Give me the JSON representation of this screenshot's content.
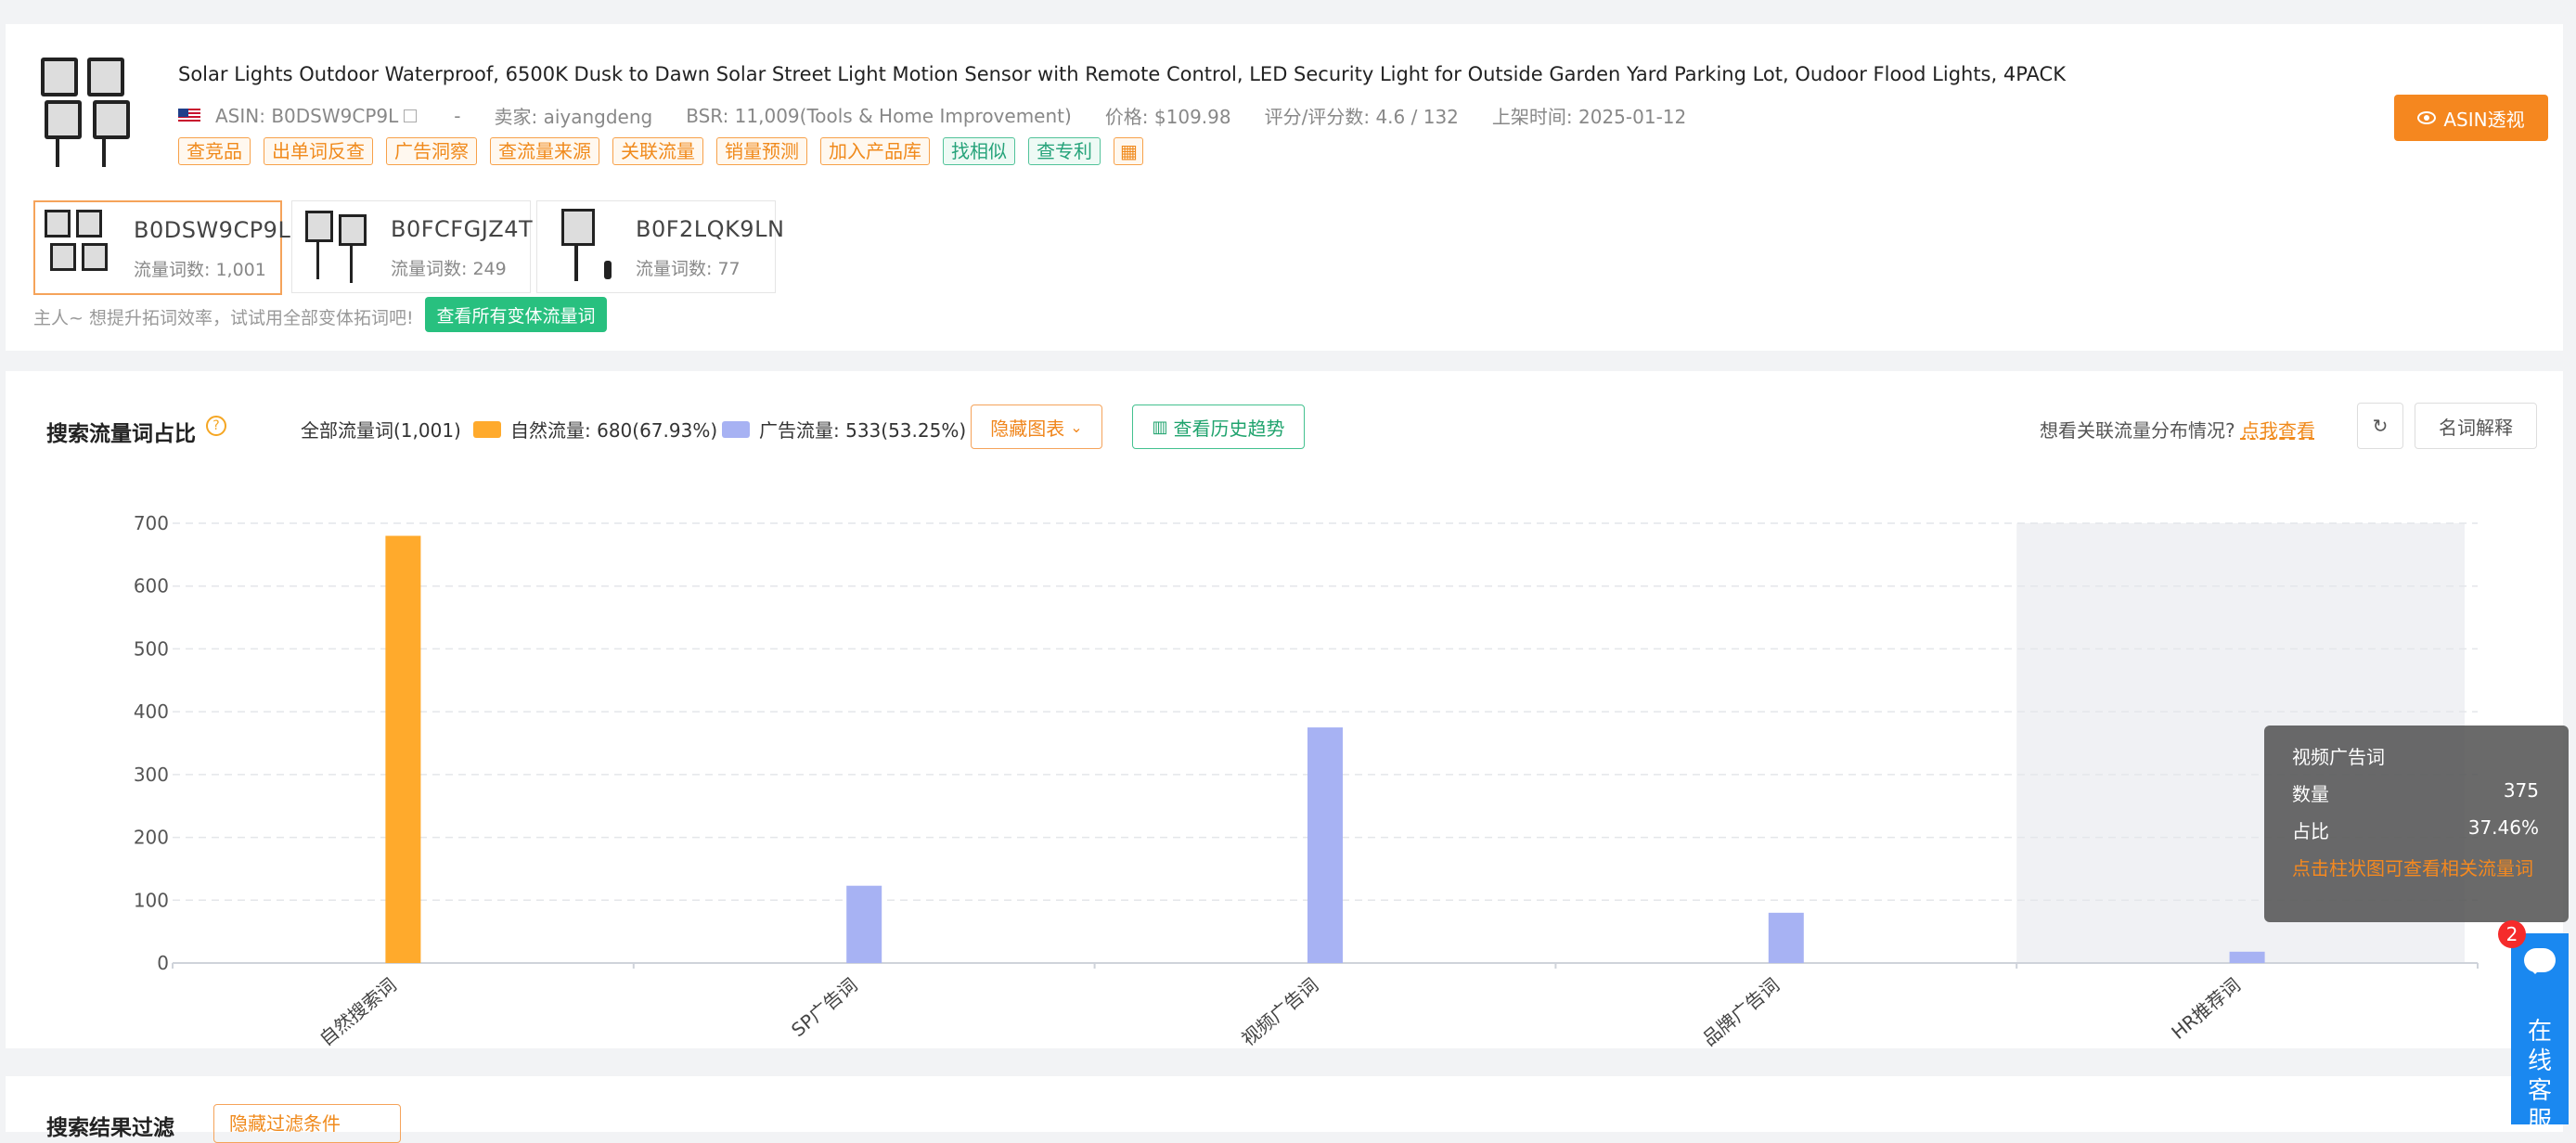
{
  "product": {
    "title": "Solar Lights Outdoor Waterproof, 6500K Dusk to Dawn Solar Street Light Motion Sensor with Remote Control, LED Security Light for Outside Garden Yard Parking Lot, Oudoor Flood Lights, 4PACK",
    "asin": "ASIN: B0DSW9CP9L",
    "dash": "-",
    "seller": "卖家: aiyangdeng",
    "bsr": "BSR: 11,009(Tools & Home Improvement)",
    "price": "价格: $109.98",
    "rating": "评分/评分数: 4.6 / 132",
    "listed": "上架时间: 2025-01-12",
    "tags": [
      "查竞品",
      "出单词反查",
      "广告洞察",
      "查流量来源",
      "关联流量",
      "销量预测",
      "加入产品库",
      "找相似",
      "查专利"
    ],
    "asin_button": "ASIN透视"
  },
  "variants": [
    {
      "asin": "B0DSW9CP9L",
      "count": "流量词数: 1,001"
    },
    {
      "asin": "B0FCFGJZ4T",
      "count": "流量词数: 249"
    },
    {
      "asin": "B0F2LQK9LN",
      "count": "流量词数: 77"
    }
  ],
  "hint": "主人~ 想提升拓词效率，试试用全部变体拓词吧!",
  "all_variants_button": "查看所有变体流量词",
  "section": {
    "title": "搜索流量词占比",
    "all_words": "全部流量词(1,001)",
    "natural": "自然流量: 680(67.93%)",
    "ad": "广告流量: 533(53.25%)",
    "hide_chart": "隐藏图表",
    "history": "查看历史趋势",
    "related_q": "想看关联流量分布情况?",
    "related_link": "点我查看",
    "glossary": "名词解释"
  },
  "colors": {
    "natural": "#ffaa2c",
    "ad": "#a7b2f3",
    "accent": "#f5871f"
  },
  "chart_data": {
    "type": "bar",
    "categories": [
      "自然搜索词",
      "SP广告词",
      "视频广告词",
      "品牌广告词",
      "HR推荐词"
    ],
    "values": [
      680,
      123,
      375,
      80,
      18
    ],
    "series_type": [
      "natural",
      "ad",
      "ad",
      "ad",
      "ad"
    ],
    "yticks": [
      0,
      100,
      200,
      300,
      400,
      500,
      600,
      700
    ],
    "ylim": [
      0,
      700
    ],
    "highlighted_category": 4
  },
  "tooltip": {
    "name": "视频广告词",
    "count_label": "数量",
    "count": "375",
    "ratio_label": "占比",
    "ratio": "37.46%",
    "link": "点击柱状图可查看相关流量词"
  },
  "chat": {
    "badge": "2",
    "label": "在线客服"
  },
  "filter": {
    "title": "搜索结果过滤",
    "button": "隐藏过滤条件"
  }
}
